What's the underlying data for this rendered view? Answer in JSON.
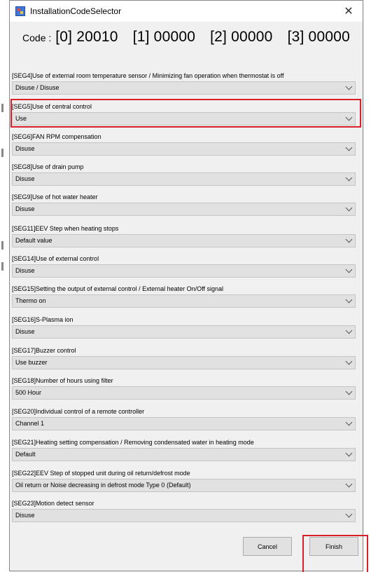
{
  "window": {
    "title": "InstallationCodeSelector"
  },
  "code": {
    "label": "Code :",
    "values": [
      "[0] 20010",
      "[1] 00000",
      "[2] 00000",
      "[3] 00000"
    ]
  },
  "segments": [
    {
      "label": "[SEG4]Use of external room temperature sensor / Minimizing fan operation when thermostat is off",
      "value": "Disuse / Disuse"
    },
    {
      "label": "[SEG5]Use of central control",
      "value": "Use"
    },
    {
      "label": "[SEG6]FAN RPM compensation",
      "value": "Disuse"
    },
    {
      "label": "[SEG8]Use of drain pump",
      "value": "Disuse"
    },
    {
      "label": "[SEG9]Use of hot water heater",
      "value": "Disuse"
    },
    {
      "label": "[SEG11]EEV Step when heating stops",
      "value": "Default value"
    },
    {
      "label": "[SEG14]Use of external control",
      "value": "Disuse"
    },
    {
      "label": "[SEG15]Setting the output of external control / External heater On/Off signal",
      "value": "Thermo on"
    },
    {
      "label": "[SEG16]S-Plasma ion",
      "value": "Disuse"
    },
    {
      "label": "[SEG17]Buzzer control",
      "value": "Use buzzer"
    },
    {
      "label": "[SEG18]Number of hours using filter",
      "value": "500 Hour"
    },
    {
      "label": "[SEG20]Individual control of a remote controller",
      "value": "Channel 1"
    },
    {
      "label": "[SEG21]Heating setting compensation / Removing condensated water in heating mode",
      "value": "Default"
    },
    {
      "label": "[SEG22]EEV Step of stopped unit during oil return/defrost mode",
      "value": "Oil return or Noise decreasing in defrost mode Type 0 (Default)"
    },
    {
      "label": "[SEG23]Motion detect sensor",
      "value": "Disuse"
    }
  ],
  "buttons": {
    "cancel": "Cancel",
    "finish": "Finish"
  },
  "colors": {
    "highlight": "#d9202a",
    "dialog_bg": "#f0f0f0",
    "combo_bg": "#e1e1e1"
  }
}
